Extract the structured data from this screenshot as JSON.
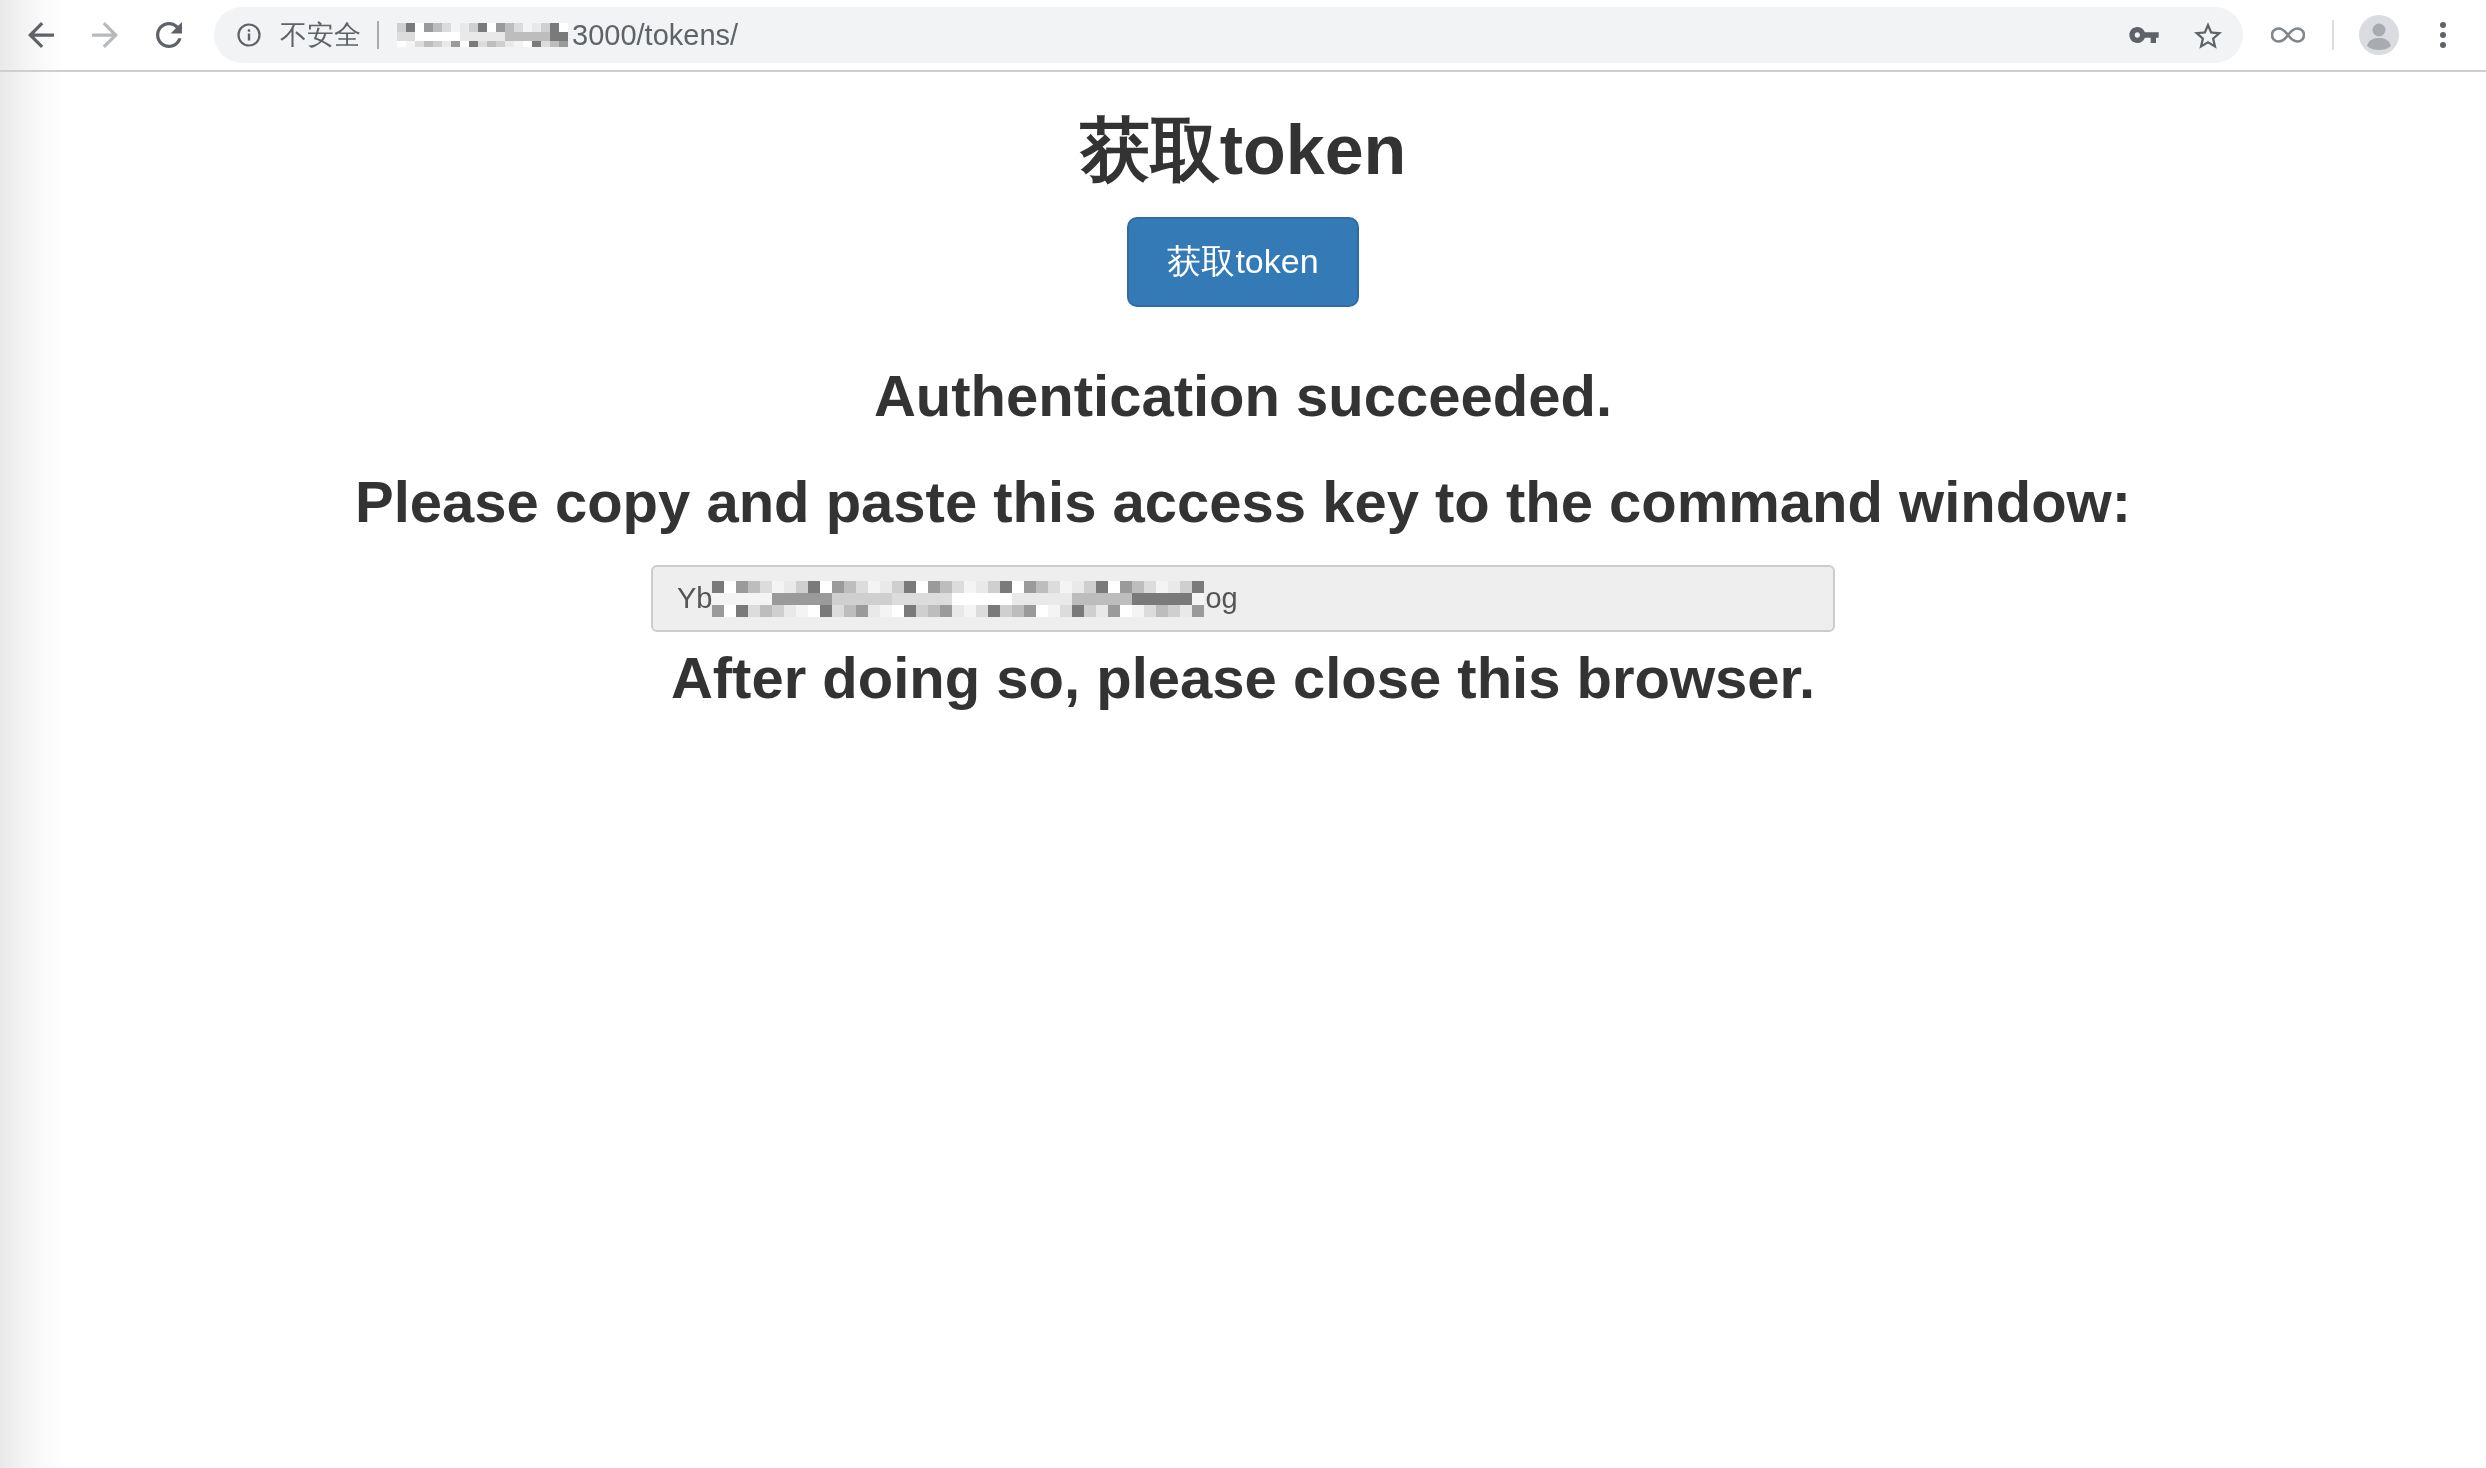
{
  "browser": {
    "nav_buttons": [
      {
        "kind": "back",
        "disabled": false
      },
      {
        "kind": "forward",
        "disabled": true
      },
      {
        "kind": "reload",
        "disabled": false
      }
    ],
    "address_bar": {
      "security_label": "不安全",
      "host_redacted": true,
      "url_tail": "3000/tokens/"
    }
  },
  "page": {
    "title": "获取token",
    "button": "获取token",
    "status": "Authentication succeeded.",
    "instruction": "Please copy and paste this access key to the command window:",
    "key_field": {
      "value_start": "Yb",
      "redacted": true,
      "value_end": "og"
    },
    "closing_note": "After doing so, please close this browser."
  }
}
